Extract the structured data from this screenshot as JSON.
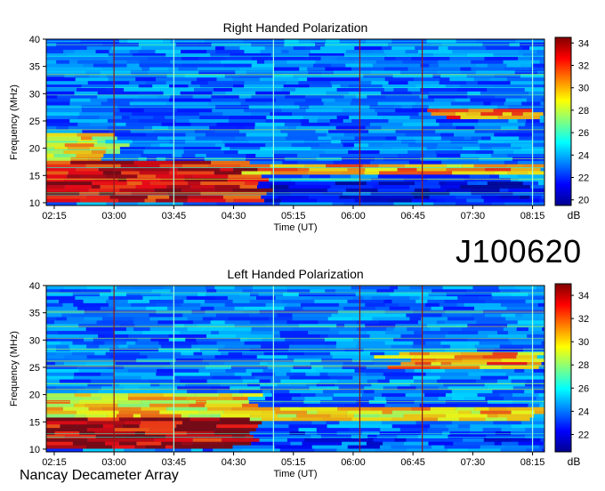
{
  "observation_id": "J100620",
  "instrument": "Nancay Decameter Array",
  "colors": {
    "colormap": [
      "#00008f",
      "#0000ff",
      "#0080ff",
      "#00ffff",
      "#80ff80",
      "#ffff00",
      "#ff8000",
      "#ff0000",
      "#800000"
    ],
    "tvline_cyan": "#a8ffe0",
    "tvline_red": "#8b1a1a",
    "frame": "#000000"
  },
  "chart_data": [
    {
      "type": "heatmap",
      "title": "Right Handed Polarization",
      "xlabel": "Time (UT)",
      "ylabel": "Frequency (MHz)",
      "x_ticks": [
        "02:15",
        "03:00",
        "03:45",
        "04:30",
        "05:15",
        "06:00",
        "06:45",
        "07:30",
        "08:15"
      ],
      "x_range": [
        "02:09",
        "08:24"
      ],
      "y_ticks": [
        10,
        15,
        20,
        25,
        30,
        35,
        40
      ],
      "ylim": [
        9.5,
        40
      ],
      "colorbar_label": "dB",
      "colorbar_ticks": [
        20,
        22,
        24,
        26,
        28,
        30,
        32,
        34
      ],
      "colorbar_range": [
        19.5,
        34.5
      ],
      "vertical_lines": [
        {
          "time": "03:00",
          "color": "red"
        },
        {
          "time": "03:45",
          "color": "cyan"
        },
        {
          "time": "05:00",
          "color": "cyan"
        },
        {
          "time": "06:05",
          "color": "red"
        },
        {
          "time": "06:52",
          "color": "red"
        },
        {
          "time": "08:15",
          "color": "cyan"
        }
      ],
      "background_level_db": 23,
      "features": [
        {
          "desc": "strong emission band",
          "freq_range": [
            10,
            18
          ],
          "time_range": [
            "02:09",
            "04:45"
          ],
          "level_db": 33
        },
        {
          "desc": "moderate emission",
          "freq_range": [
            18,
            23
          ],
          "time_range": [
            "02:09",
            "03:00"
          ],
          "level_db": 29
        },
        {
          "desc": "emission band",
          "freq_range": [
            15,
            17
          ],
          "time_range": [
            "04:45",
            "08:24"
          ],
          "level_db": 30
        },
        {
          "desc": "band near 26 MHz",
          "freq_range": [
            25.5,
            27
          ],
          "time_range": [
            "07:00",
            "08:24"
          ],
          "level_db": 31
        },
        {
          "desc": "quiet low frequency",
          "freq_range": [
            10,
            14
          ],
          "time_range": [
            "04:45",
            "08:24"
          ],
          "level_db": 21
        }
      ]
    },
    {
      "type": "heatmap",
      "title": "Left Handed Polarization",
      "xlabel": "Time (UT)",
      "ylabel": "Frequency (MHz)",
      "x_ticks": [
        "02:15",
        "03:00",
        "03:45",
        "04:30",
        "05:15",
        "06:00",
        "06:45",
        "07:30",
        "08:15"
      ],
      "x_range": [
        "02:09",
        "08:24"
      ],
      "y_ticks": [
        10,
        15,
        20,
        25,
        30,
        35,
        40
      ],
      "ylim": [
        9.5,
        40
      ],
      "colorbar_label": "dB",
      "colorbar_ticks": [
        22,
        24,
        26,
        28,
        30,
        32,
        34
      ],
      "colorbar_range": [
        20.5,
        35
      ],
      "vertical_lines": [
        {
          "time": "03:00",
          "color": "red"
        },
        {
          "time": "03:45",
          "color": "cyan"
        },
        {
          "time": "05:00",
          "color": "cyan"
        },
        {
          "time": "06:05",
          "color": "red"
        },
        {
          "time": "06:52",
          "color": "red"
        },
        {
          "time": "08:15",
          "color": "cyan"
        }
      ],
      "background_level_db": 24,
      "features": [
        {
          "desc": "strong emission band",
          "freq_range": [
            10,
            16
          ],
          "time_range": [
            "02:09",
            "04:45"
          ],
          "level_db": 34
        },
        {
          "desc": "moderate emission",
          "freq_range": [
            16,
            20
          ],
          "time_range": [
            "02:09",
            "04:45"
          ],
          "level_db": 30
        },
        {
          "desc": "emission band",
          "freq_range": [
            15,
            18
          ],
          "time_range": [
            "04:45",
            "08:24"
          ],
          "level_db": 30
        },
        {
          "desc": "band near 26 MHz",
          "freq_range": [
            24.5,
            28
          ],
          "time_range": [
            "06:30",
            "08:24"
          ],
          "level_db": 31
        },
        {
          "desc": "quiet low frequency",
          "freq_range": [
            10,
            13
          ],
          "time_range": [
            "04:45",
            "08:24"
          ],
          "level_db": 23
        }
      ]
    }
  ]
}
